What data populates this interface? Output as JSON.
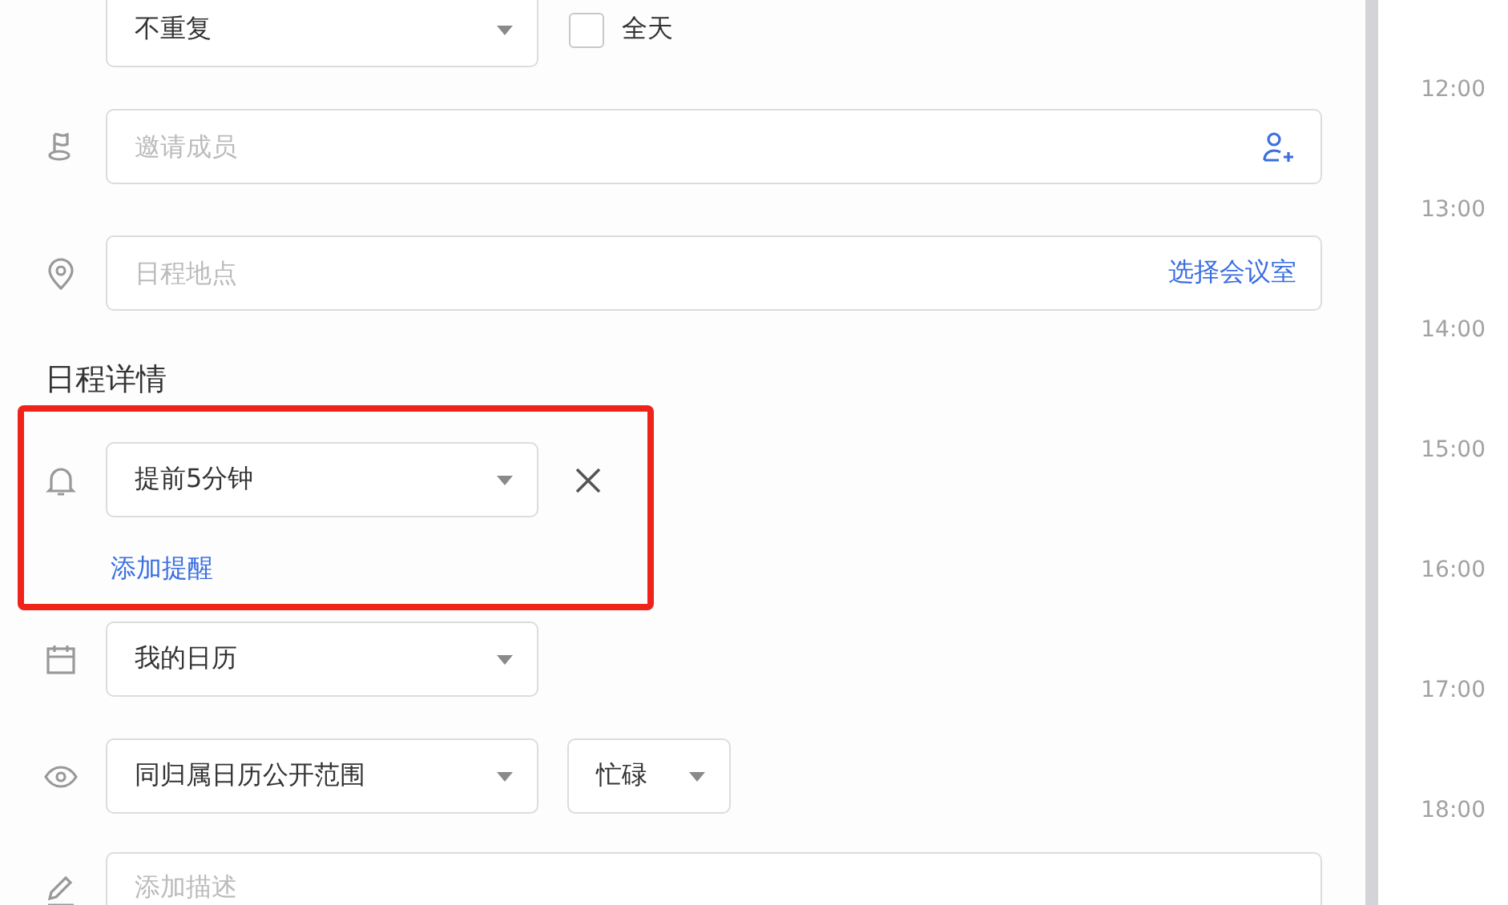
{
  "repeat": {
    "value": "不重复"
  },
  "all_day": {
    "label": "全天",
    "checked": false
  },
  "invite": {
    "placeholder": "邀请成员"
  },
  "location": {
    "placeholder": "日程地点",
    "action": "选择会议室"
  },
  "section_title": "日程详情",
  "reminder_section": {
    "highlight": true,
    "reminders": [
      {
        "value": "提前5分钟"
      }
    ],
    "add_label": "添加提醒"
  },
  "calendar": {
    "value": "我的日历"
  },
  "visibility": {
    "value": "同归属日历公开范围"
  },
  "busy": {
    "value": "忙碌"
  },
  "description": {
    "placeholder": "添加描述"
  },
  "timeline": [
    "12:00",
    "13:00",
    "14:00",
    "15:00",
    "16:00",
    "17:00",
    "18:00"
  ]
}
